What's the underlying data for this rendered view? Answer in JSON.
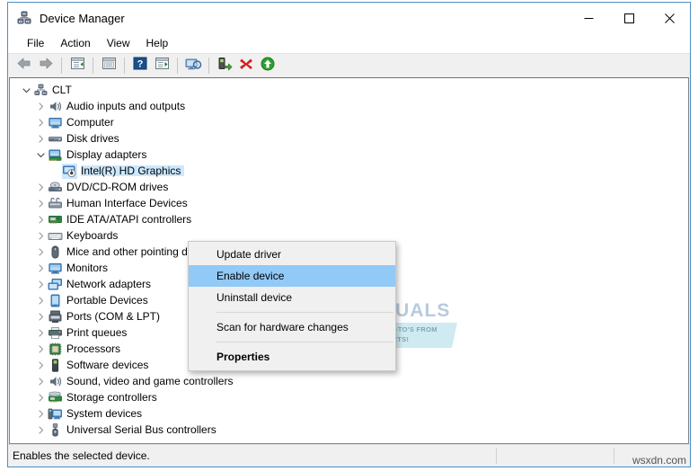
{
  "window": {
    "title": "Device Manager",
    "title_icon": "device-manager-icon",
    "controls": {
      "minimize": "minimize-icon",
      "maximize": "maximize-icon",
      "close": "close-icon"
    }
  },
  "menubar": {
    "items": [
      {
        "label": "File"
      },
      {
        "label": "Action"
      },
      {
        "label": "View"
      },
      {
        "label": "Help"
      }
    ]
  },
  "toolbar": {
    "buttons": [
      {
        "name": "back-button",
        "icon": "back-arrow-icon"
      },
      {
        "name": "forward-button",
        "icon": "forward-arrow-icon"
      },
      {
        "name": "separator-1",
        "icon": "separator"
      },
      {
        "name": "show-hide-console-tree-button",
        "icon": "console-tree-icon"
      },
      {
        "name": "separator-2",
        "icon": "separator"
      },
      {
        "name": "properties-button",
        "icon": "properties-window-icon"
      },
      {
        "name": "separator-3",
        "icon": "separator"
      },
      {
        "name": "help-button",
        "icon": "question-mark-icon"
      },
      {
        "name": "show-details-button",
        "icon": "details-pane-icon"
      },
      {
        "name": "separator-4",
        "icon": "separator"
      },
      {
        "name": "scan-hardware-changes-button",
        "icon": "scan-monitor-icon"
      },
      {
        "name": "separator-5",
        "icon": "separator"
      },
      {
        "name": "update-driver-button",
        "icon": "update-driver-icon"
      },
      {
        "name": "uninstall-device-button",
        "icon": "red-x-icon"
      },
      {
        "name": "enable-device-button",
        "icon": "green-up-arrow-icon"
      }
    ]
  },
  "tree": {
    "nodes": [
      {
        "label": "CLT",
        "depth": 0,
        "expanded": true,
        "icon": "computer-root-icon",
        "selected": false
      },
      {
        "label": "Audio inputs and outputs",
        "depth": 1,
        "expanded": false,
        "icon": "speaker-icon",
        "selected": false
      },
      {
        "label": "Computer",
        "depth": 1,
        "expanded": false,
        "icon": "monitor-icon",
        "selected": false
      },
      {
        "label": "Disk drives",
        "depth": 1,
        "expanded": false,
        "icon": "disk-drive-icon",
        "selected": false
      },
      {
        "label": "Display adapters",
        "depth": 1,
        "expanded": true,
        "icon": "display-adapter-icon",
        "selected": false
      },
      {
        "label": "Intel(R) HD Graphics",
        "depth": 2,
        "expanded": null,
        "icon": "graphics-card-disabled-icon",
        "selected": true
      },
      {
        "label": "DVD/CD-ROM drives",
        "depth": 1,
        "expanded": false,
        "icon": "optical-drive-icon",
        "selected": false
      },
      {
        "label": "Human Interface Devices",
        "depth": 1,
        "expanded": false,
        "icon": "hid-icon",
        "selected": false
      },
      {
        "label": "IDE ATA/ATAPI controllers",
        "depth": 1,
        "expanded": false,
        "icon": "ide-controller-icon",
        "selected": false
      },
      {
        "label": "Keyboards",
        "depth": 1,
        "expanded": false,
        "icon": "keyboard-icon",
        "selected": false
      },
      {
        "label": "Mice and other pointing devices",
        "depth": 1,
        "expanded": false,
        "icon": "mouse-icon",
        "selected": false
      },
      {
        "label": "Monitors",
        "depth": 1,
        "expanded": false,
        "icon": "monitor-icon",
        "selected": false
      },
      {
        "label": "Network adapters",
        "depth": 1,
        "expanded": false,
        "icon": "network-adapter-icon",
        "selected": false
      },
      {
        "label": "Portable Devices",
        "depth": 1,
        "expanded": false,
        "icon": "portable-device-icon",
        "selected": false
      },
      {
        "label": "Ports (COM & LPT)",
        "depth": 1,
        "expanded": false,
        "icon": "port-icon",
        "selected": false
      },
      {
        "label": "Print queues",
        "depth": 1,
        "expanded": false,
        "icon": "printer-icon",
        "selected": false
      },
      {
        "label": "Processors",
        "depth": 1,
        "expanded": false,
        "icon": "processor-icon",
        "selected": false
      },
      {
        "label": "Software devices",
        "depth": 1,
        "expanded": false,
        "icon": "software-device-icon",
        "selected": false
      },
      {
        "label": "Sound, video and game controllers",
        "depth": 1,
        "expanded": false,
        "icon": "speaker-icon",
        "selected": false
      },
      {
        "label": "Storage controllers",
        "depth": 1,
        "expanded": false,
        "icon": "storage-controller-icon",
        "selected": false
      },
      {
        "label": "System devices",
        "depth": 1,
        "expanded": false,
        "icon": "system-device-icon",
        "selected": false
      },
      {
        "label": "Universal Serial Bus controllers",
        "depth": 1,
        "expanded": false,
        "icon": "usb-controller-icon",
        "selected": false
      }
    ]
  },
  "context_menu": {
    "items": [
      {
        "label": "Update driver",
        "type": "item",
        "highlighted": false,
        "bold": false
      },
      {
        "label": "Enable device",
        "type": "item",
        "highlighted": true,
        "bold": false
      },
      {
        "label": "Uninstall device",
        "type": "item",
        "highlighted": false,
        "bold": false
      },
      {
        "type": "separator"
      },
      {
        "label": "Scan for hardware changes",
        "type": "item",
        "highlighted": false,
        "bold": false
      },
      {
        "type": "separator"
      },
      {
        "label": "Properties",
        "type": "item",
        "highlighted": false,
        "bold": true
      }
    ],
    "highlight_color": "#91c9f7"
  },
  "watermark": {
    "brand": "APPUALS",
    "tagline_line1": "TECH HOW-TO'S FROM",
    "tagline_line2": "THE EXPERTS!"
  },
  "statusbar": {
    "message": "Enables the selected device.",
    "corner_text": "wsxdn.com"
  },
  "colors": {
    "window_border": "#4a90c4",
    "tree_selection": "#cce8ff",
    "menu_highlight": "#91c9f7",
    "toolbar_bg": "#f0f0f0"
  }
}
